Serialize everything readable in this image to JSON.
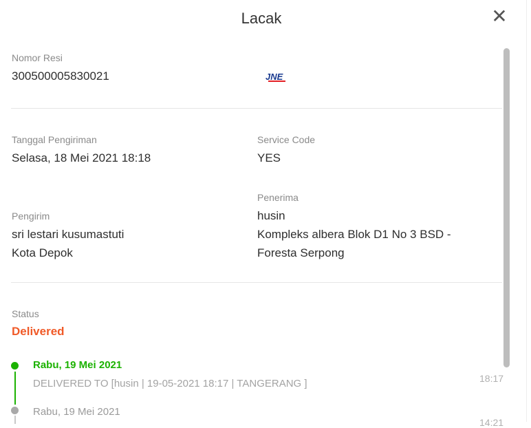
{
  "modal": {
    "title": "Lacak"
  },
  "resi": {
    "label": "Nomor Resi",
    "value": "300500005830021",
    "courier_logo": "JNE"
  },
  "shipping": {
    "date_label": "Tanggal Pengiriman",
    "date_value": "Selasa, 18 Mei 2021 18:18",
    "service_label": "Service Code",
    "service_value": "YES"
  },
  "sender": {
    "label": "Pengirim",
    "name": "sri lestari kusumastuti",
    "city": "Kota Depok"
  },
  "recipient": {
    "label": "Penerima",
    "name": "husin",
    "address_line1": "Kompleks albera Blok D1 No 3 BSD -",
    "address_line2": "Foresta Serpong"
  },
  "status": {
    "label": "Status",
    "value": "Delivered",
    "color": "#f05a28"
  },
  "timeline": [
    {
      "date": "Rabu, 19 Mei 2021",
      "desc": "DELIVERED TO [husin | 19-05-2021 18:17 | TANGERANG ]",
      "time": "18:17",
      "color": "#1bb200"
    },
    {
      "date": "Rabu, 19 Mei 2021",
      "desc": "",
      "time": "14:21",
      "color": "#a9a9a9"
    }
  ]
}
